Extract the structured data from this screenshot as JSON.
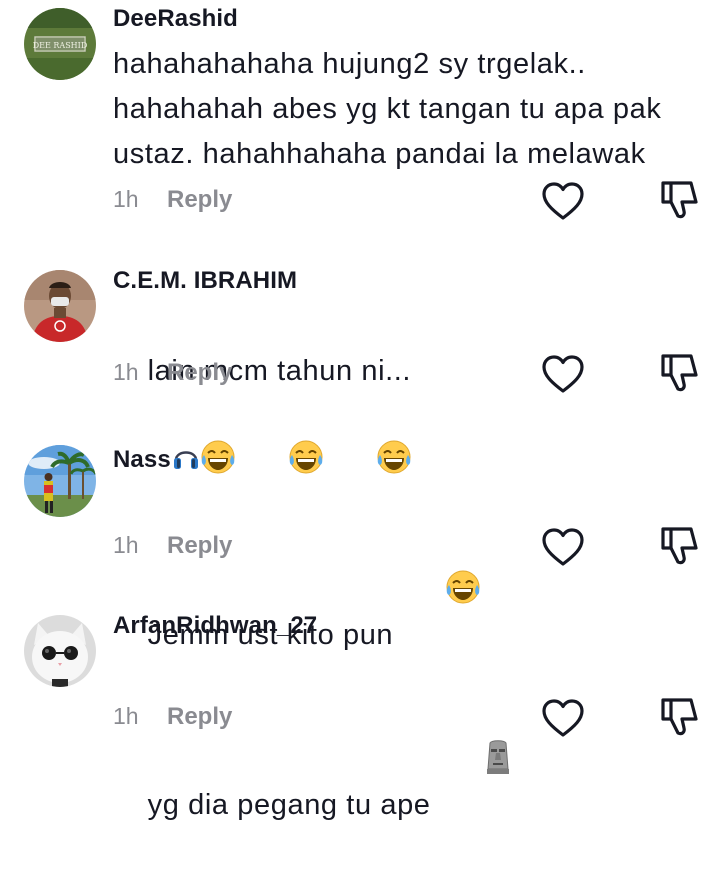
{
  "comments": [
    {
      "username": "DeeRashid",
      "text": "hahahahahaha hujung2 sy trgelak..\nhahahahah abes yg kt tangan tu apa pak\nustaz. hahahhahaha pandai la melawak",
      "time": "1h",
      "reply_label": "Reply",
      "avatar_icon": "sign-board-avatar",
      "avatar_text": "DEE RASHID"
    },
    {
      "username": "C.E.M. IBRAHIM",
      "text": "lain mcm tahun ni...",
      "emojis": [
        "face-with-tears-of-joy-emoji",
        "face-with-tears-of-joy-emoji",
        "face-with-tears-of-joy-emoji"
      ],
      "time": "1h",
      "reply_label": "Reply",
      "avatar_icon": "person-red-shirt-avatar"
    },
    {
      "username": "Nass",
      "username_emoji": "headphone-emoji",
      "text": "Jemm ust kito pun",
      "emojis": [
        "face-with-tears-of-joy-emoji"
      ],
      "time": "1h",
      "reply_label": "Reply",
      "avatar_icon": "palm-trees-avatar"
    },
    {
      "username": "ArfanRidhwan_27",
      "text": "yg dia pegang tu ape",
      "emojis": [
        "moai-emoji"
      ],
      "time": "1h",
      "reply_label": "Reply",
      "avatar_icon": "cat-sunglasses-avatar"
    }
  ],
  "icons": {
    "like": "heart-outline-icon",
    "dislike": "thumbs-down-outline-icon"
  },
  "colors": {
    "text_primary": "#161823",
    "text_secondary": "#8a8b91",
    "icon": "#161823"
  }
}
